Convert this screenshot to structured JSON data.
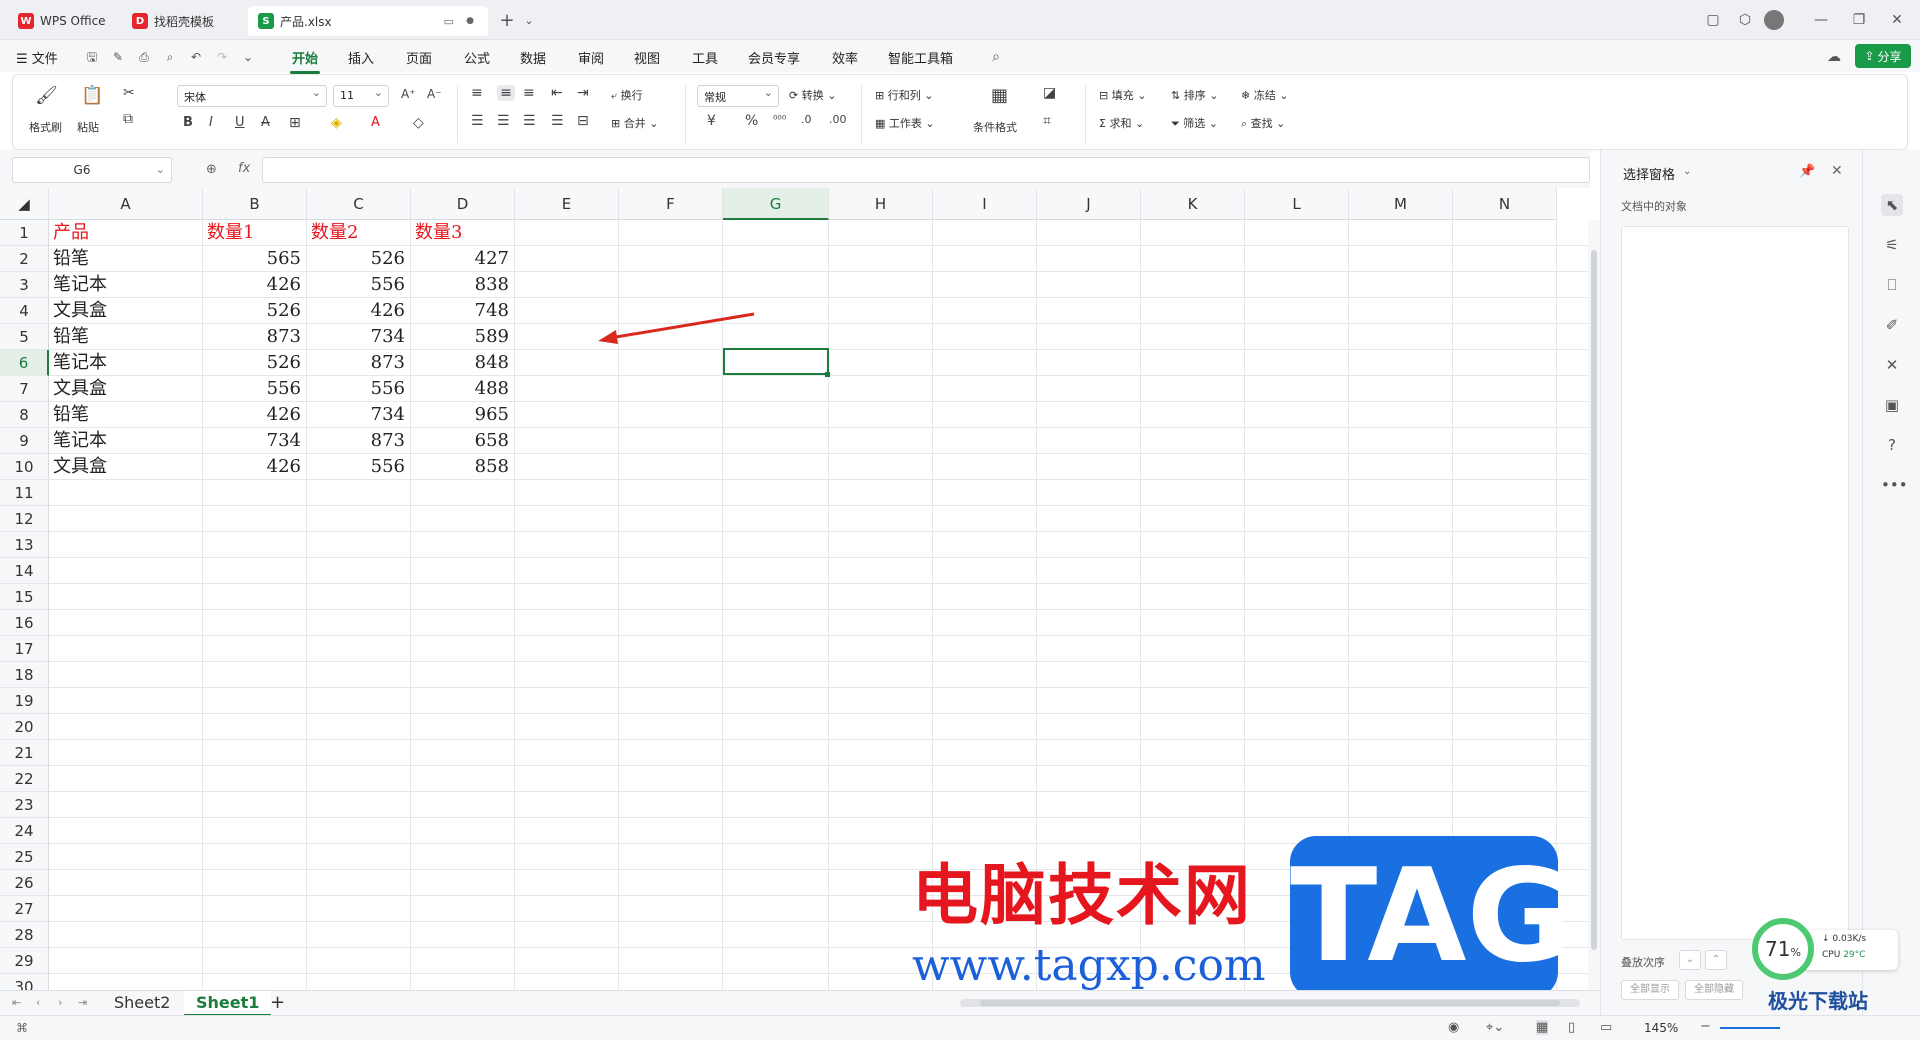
{
  "titlebar": {
    "tabs": [
      {
        "label": "WPS Office",
        "badge": "W",
        "color": "#e5262e"
      },
      {
        "label": "找稻壳模板",
        "badge": "D",
        "color": "#e5262e"
      },
      {
        "label": "产品.xlsx",
        "badge": "S",
        "color": "#1a9b4a"
      }
    ],
    "new_tab": "+"
  },
  "menubar": {
    "file": "文件",
    "items": [
      "开始",
      "插入",
      "页面",
      "公式",
      "数据",
      "审阅",
      "视图",
      "工具",
      "会员专享",
      "效率",
      "智能工具箱"
    ],
    "active": "开始",
    "share": "分享"
  },
  "ribbon": {
    "format_painter": "格式刷",
    "paste": "粘贴",
    "font_name": "宋体",
    "font_size": "11",
    "bold": "B",
    "italic": "I",
    "underline": "U",
    "wrap": "换行",
    "merge": "合并",
    "number_format": "常规",
    "convert": "转换",
    "rows_cols": "行和列",
    "worksheet": "工作表",
    "conditional_format": "条件格式",
    "fill": "填充",
    "sort": "排序",
    "freeze": "冻结",
    "sum": "求和",
    "filter": "筛选",
    "find": "查找",
    "currency": "¥",
    "percent": "%"
  },
  "formula_bar": {
    "name_box": "G6",
    "fx": "fx",
    "value": ""
  },
  "sheet": {
    "columns": [
      "A",
      "B",
      "C",
      "D",
      "E",
      "F",
      "G",
      "H",
      "I",
      "J",
      "K",
      "L",
      "M",
      "N"
    ],
    "selected_column": "G",
    "selected_row": 6,
    "rows": [
      "1",
      "2",
      "3",
      "4",
      "5",
      "6",
      "7",
      "8",
      "9",
      "10",
      "11",
      "12",
      "13",
      "14",
      "15",
      "16",
      "17",
      "18",
      "19",
      "20",
      "21",
      "22",
      "23",
      "24",
      "25",
      "26",
      "27",
      "28",
      "29",
      "30"
    ],
    "header": [
      "产品",
      "数量1",
      "数量2",
      "数量3"
    ],
    "header_color": "#e5161e",
    "data": [
      [
        "铅笔",
        "565",
        "526",
        "427"
      ],
      [
        "笔记本",
        "426",
        "556",
        "838"
      ],
      [
        "文具盒",
        "526",
        "426",
        "748"
      ],
      [
        "铅笔",
        "873",
        "734",
        "589"
      ],
      [
        "笔记本",
        "526",
        "873",
        "848"
      ],
      [
        "文具盒",
        "556",
        "556",
        "488"
      ],
      [
        "铅笔",
        "426",
        "734",
        "965"
      ],
      [
        "笔记本",
        "734",
        "873",
        "658"
      ],
      [
        "文具盒",
        "426",
        "556",
        "858"
      ]
    ]
  },
  "sheet_tabs": {
    "tabs": [
      "Sheet2",
      "Sheet1"
    ],
    "active": "Sheet1",
    "add": "+"
  },
  "side_pane": {
    "title": "选择窗格",
    "subtitle": "文档中的对象",
    "order_label": "叠放次序",
    "show_all": "全部显示",
    "hide_all": "全部隐藏"
  },
  "status": {
    "zoom": "145%"
  },
  "cpu_widget": {
    "percent": "71",
    "unit": "%",
    "net": "0.03K/s",
    "cpu": "CPU",
    "temp": "29°C"
  },
  "watermark": {
    "cn": "电脑技术网",
    "url": "www.tagxp.com",
    "tag": "TAG",
    "site2": "极光下载站"
  },
  "accent": "#1a7d3c"
}
